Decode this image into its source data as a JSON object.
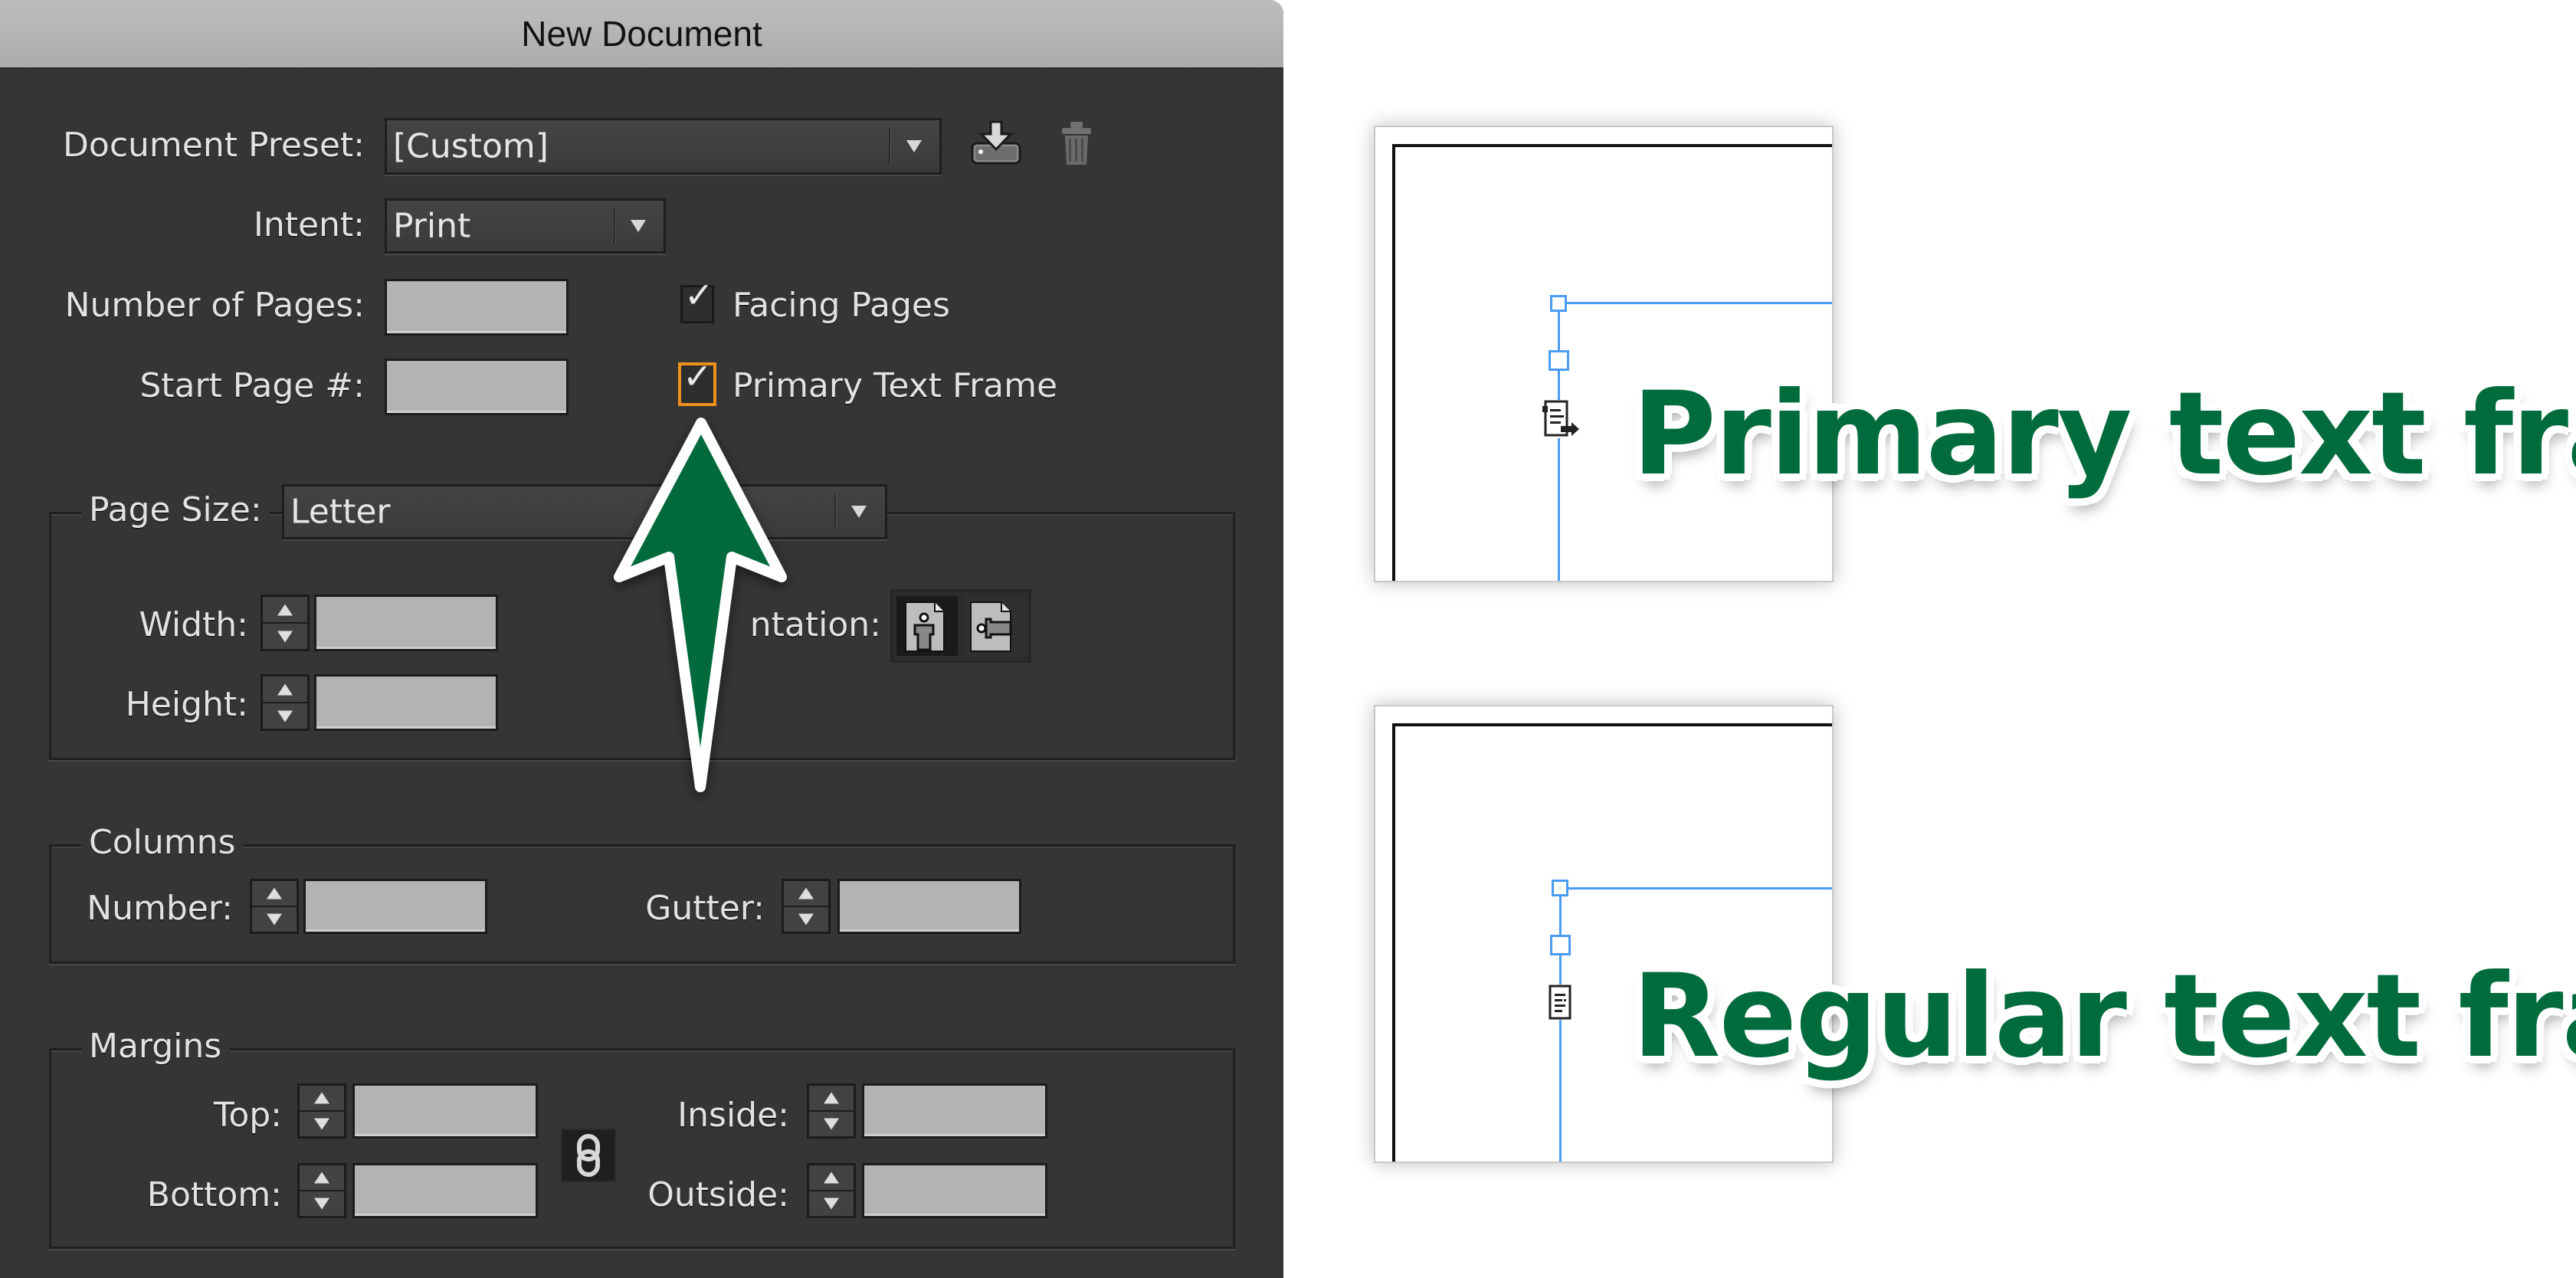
{
  "dialog": {
    "title": "New Document",
    "document_preset": {
      "label": "Document Preset:",
      "value": "[Custom]"
    },
    "intent": {
      "label": "Intent:",
      "value": "Print"
    },
    "number_of_pages": {
      "label": "Number of Pages:",
      "value": ""
    },
    "start_page": {
      "label": "Start Page #:",
      "value": ""
    },
    "facing_pages": {
      "label": "Facing Pages",
      "checked": true
    },
    "primary_text_frame": {
      "label": "Primary Text Frame",
      "checked": true,
      "focused": true
    },
    "page_size": {
      "label": "Page Size:",
      "value": "Letter",
      "width_label": "Width:",
      "width_value": "",
      "height_label": "Height:",
      "height_value": "",
      "orientation_label": "Orientation:",
      "orientation_visible_label": "ntation:",
      "orientation_options": [
        "portrait",
        "landscape"
      ],
      "orientation_selected": "portrait"
    },
    "columns": {
      "legend": "Columns",
      "number_label": "Number:",
      "number_value": "",
      "gutter_label": "Gutter:",
      "gutter_value": ""
    },
    "margins": {
      "legend": "Margins",
      "top_label": "Top:",
      "top_value": "",
      "bottom_label": "Bottom:",
      "bottom_value": "",
      "inside_label": "Inside:",
      "inside_value": "",
      "outside_label": "Outside:",
      "outside_value": "",
      "link_icon": "chain-link-icon"
    },
    "icons": {
      "save_preset": "save-preset-icon",
      "delete_preset": "trash-icon"
    }
  },
  "annotations": {
    "arrow_color": "#006b3c",
    "primary_caption": "Primary text frame",
    "regular_caption": "Regular text frame",
    "caption_color": "#006b3c",
    "guide_color": "#4a9cf0",
    "focus_color": "#f0901e"
  }
}
